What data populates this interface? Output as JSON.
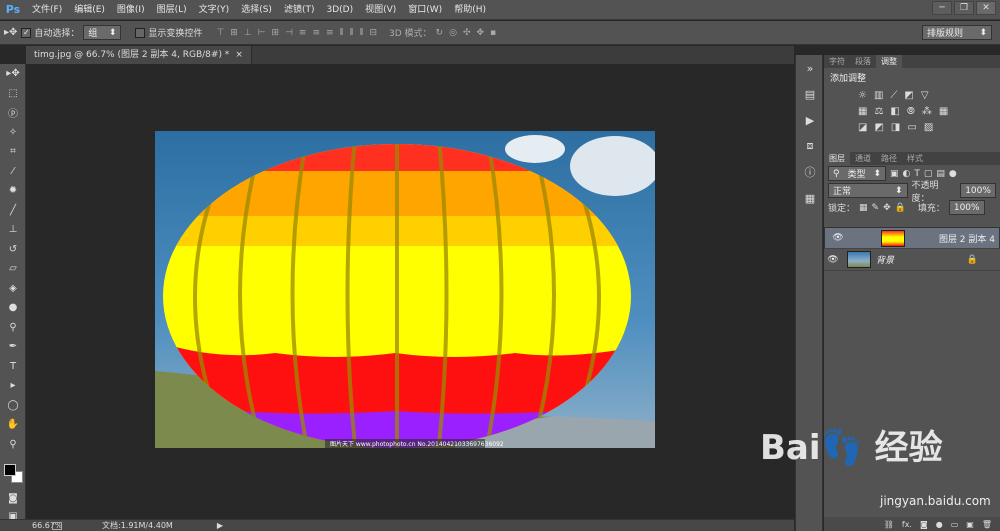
{
  "menubar": {
    "logo": "Ps",
    "items": [
      "文件(F)",
      "编辑(E)",
      "图像(I)",
      "图层(L)",
      "文字(Y)",
      "选择(S)",
      "滤镜(T)",
      "3D(D)",
      "视图(V)",
      "窗口(W)",
      "帮助(H)"
    ],
    "window_controls": [
      "─",
      "❐",
      "✕"
    ]
  },
  "options": {
    "auto_select_label": "自动选择：",
    "auto_select_value": "组",
    "show_transform_label": "显示变换控件",
    "mode_label": "3D 模式：",
    "workspace": "排版规则"
  },
  "document": {
    "tab_title": "timg.jpg @ 66.7% (图层 2 副本 4, RGB/8#) *",
    "close": "×",
    "watermark": "图片天下 www.photophoto.cn  No.20140421033697636092"
  },
  "status": {
    "zoom": "66.67%",
    "doc_info": "文档:1.91M/4.40M"
  },
  "panels": {
    "top_tabs": [
      "字符",
      "段落",
      "调整"
    ],
    "adjust_title": "添加调整",
    "layer_tabs": [
      "图层",
      "通道",
      "路径",
      "样式"
    ],
    "filter_kind": "类型",
    "blend_mode": "正常",
    "opacity_label": "不透明度：",
    "opacity_value": "100%",
    "lock_label": "锁定：",
    "fill_label": "填充：",
    "fill_value": "100%",
    "layers": [
      {
        "name": "图层 2 副本 4"
      },
      {
        "name": "背景"
      }
    ],
    "bottom_icons": [
      "fx.",
      "◙",
      "●",
      "▭",
      "▣",
      "🗑"
    ]
  },
  "watermark": {
    "brand": "Bai👣 经验",
    "url": "jingyan.baidu.com"
  }
}
